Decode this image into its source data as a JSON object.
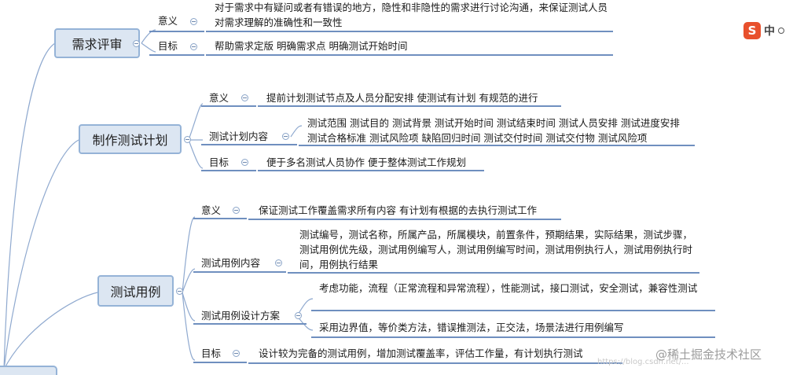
{
  "nodes": {
    "review": {
      "title": "需求评审",
      "meaning_label": "意义",
      "meaning_text": "对于需求中有疑问或者有错误的地方，隐性和非隐性的需求进行讨论沟通，来保证测试人员对需求理解的准确性和一致性",
      "goal_label": "目标",
      "goal_text": "帮助需求定版  明确需求点  明确测试开始时间"
    },
    "plan": {
      "title": "制作测试计划",
      "meaning_label": "意义",
      "meaning_text": "提前计划测试节点及人员分配安排 使测试有计划  有规范的进行",
      "content_label": "测试计划内容",
      "content_text": "测试范围 测试目的  测试背景 测试开始时间 测试结束时间 测试人员安排 测试进度安排  测试合格标准  测试风险项  缺陷回归时间 测试交付时间 测试交付物  测试风险项",
      "goal_label": "目标",
      "goal_text": "便于多名测试人员协作 便于整体测试工作规划"
    },
    "cases": {
      "title": "测试用例",
      "meaning_label": "意义",
      "meaning_text": "保证测试工作覆盖需求所有内容  有计划有根据的去执行测试工作",
      "content_label": "测试用例内容",
      "content_text": "测试编号，测试名称，所属产品，所属模块，前置条件，预期结果，实际结果，测试步骤，测试用例优先级，测试用例编写人，测试用例编写时间，测试用例执行人，测试用例执行时间，用例执行结果",
      "design_label": "测试用例设计方案",
      "design_items": [
        "考虑功能，流程（正常流程和异常流程），性能测试，接口测试，安全测试，兼容性测试",
        "采用边界值，等价类方法，错误推测法，正交法，场景法进行用例编写"
      ],
      "goal_label": "目标",
      "goal_text": "设计较为完备的测试用例，增加测试覆盖率，评估工作量，有计划执行测试"
    }
  },
  "ime": {
    "logo": "S",
    "mode": "中"
  },
  "watermark": {
    "main": "@稀土掘金技术社区",
    "faint": "https://blog.csdn.net/..."
  },
  "colors": {
    "line": "#6f8fbf",
    "topic_fill": "#dce6f2",
    "topic_border": "#95b3d7"
  }
}
